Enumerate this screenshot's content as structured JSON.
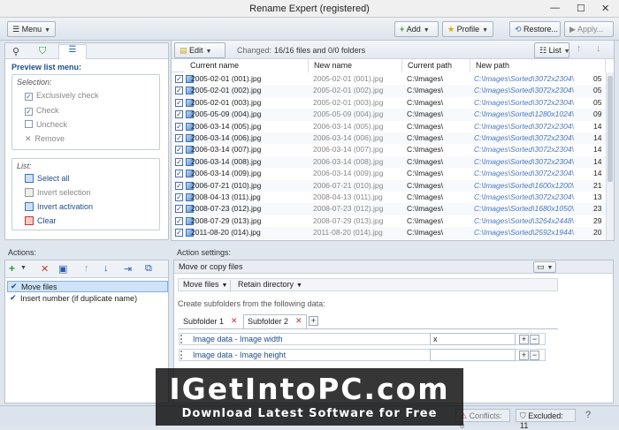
{
  "window": {
    "title": "Rename Expert (registered)"
  },
  "toolbar": {
    "menu": "Menu",
    "add": "Add",
    "profile": "Profile",
    "restore": "Restore...",
    "apply": "Apply..."
  },
  "left": {
    "heading": "Preview list menu:",
    "selection": {
      "title": "Selection:",
      "items": [
        "Exclusively check",
        "Check",
        "Uncheck",
        "Remove"
      ]
    },
    "list": {
      "title": "List:",
      "items": [
        "Select all",
        "Invert selection",
        "Invert activation",
        "Clear"
      ]
    }
  },
  "grid": {
    "edit": "Edit",
    "changed_label": "Changed:",
    "changed_value": "16/16 files and 0/0 folders",
    "view": "List",
    "columns": [
      "Current name",
      "New name",
      "Current path",
      "New path"
    ],
    "rows": [
      {
        "cur": "2005-02-01 (001).jpg",
        "new": "2005-02-01 (001).jpg",
        "path": "C:\\Images\\",
        "np": "C:\\Images\\Sorted\\3072x2304\\",
        "x": "05"
      },
      {
        "cur": "2005-02-01 (002).jpg",
        "new": "2005-02-01 (002).jpg",
        "path": "C:\\Images\\",
        "np": "C:\\Images\\Sorted\\3072x2304\\",
        "x": "05"
      },
      {
        "cur": "2005-02-01 (003).jpg",
        "new": "2005-02-01 (003).jpg",
        "path": "C:\\Images\\",
        "np": "C:\\Images\\Sorted\\3072x2304\\",
        "x": "05"
      },
      {
        "cur": "2005-05-09 (004).jpg",
        "new": "2005-05-09 (004).jpg",
        "path": "C:\\Images\\",
        "np": "C:\\Images\\Sorted\\1280x1024\\",
        "x": "09"
      },
      {
        "cur": "2006-03-14 (005).jpg",
        "new": "2006-03-14 (005).jpg",
        "path": "C:\\Images\\",
        "np": "C:\\Images\\Sorted\\3072x2304\\",
        "x": "14"
      },
      {
        "cur": "2006-03-14 (006).jpg",
        "new": "2006-03-14 (006).jpg",
        "path": "C:\\Images\\",
        "np": "C:\\Images\\Sorted\\3072x2304\\",
        "x": "14"
      },
      {
        "cur": "2006-03-14 (007).jpg",
        "new": "2006-03-14 (007).jpg",
        "path": "C:\\Images\\",
        "np": "C:\\Images\\Sorted\\3072x2304\\",
        "x": "14"
      },
      {
        "cur": "2006-03-14 (008).jpg",
        "new": "2006-03-14 (008).jpg",
        "path": "C:\\Images\\",
        "np": "C:\\Images\\Sorted\\3072x2304\\",
        "x": "14"
      },
      {
        "cur": "2006-03-14 (009).jpg",
        "new": "2006-03-14 (009).jpg",
        "path": "C:\\Images\\",
        "np": "C:\\Images\\Sorted\\3072x2304\\",
        "x": "14"
      },
      {
        "cur": "2006-07-21 (010).jpg",
        "new": "2006-07-21 (010).jpg",
        "path": "C:\\Images\\",
        "np": "C:\\Images\\Sorted\\1600x1200\\",
        "x": "21"
      },
      {
        "cur": "2008-04-13 (011).jpg",
        "new": "2008-04-13 (011).jpg",
        "path": "C:\\Images\\",
        "np": "C:\\Images\\Sorted\\3072x2304\\",
        "x": "13"
      },
      {
        "cur": "2008-07-23 (012).jpg",
        "new": "2008-07-23 (012).jpg",
        "path": "C:\\Images\\",
        "np": "C:\\Images\\Sorted\\1680x1050\\",
        "x": "23"
      },
      {
        "cur": "2008-07-29 (013).jpg",
        "new": "2008-07-29 (013).jpg",
        "path": "C:\\Images\\",
        "np": "C:\\Images\\Sorted\\3264x2448\\",
        "x": "29"
      },
      {
        "cur": "2011-08-20 (014).jpg",
        "new": "2011-08-20 (014).jpg",
        "path": "C:\\Images\\",
        "np": "C:\\Images\\Sorted\\2592x1944\\",
        "x": "20"
      }
    ]
  },
  "actions": {
    "heading": "Actions:",
    "items": [
      "Move files",
      "Insert number (if duplicate name)"
    ]
  },
  "settings": {
    "heading": "Action settings:",
    "panel_title": "Move or copy files",
    "move_select": "Move files",
    "retain_select": "Retain directory",
    "subfolders_label": "Create subfolders from the following data:",
    "tabs": [
      "Subfolder 1",
      "Subfolder 2"
    ],
    "fields": [
      {
        "name": "Image data - Image width",
        "value": "x"
      },
      {
        "name": "Image data - Image height",
        "value": ""
      }
    ]
  },
  "status": {
    "conflicts": "Conflicts: 0",
    "excluded": "Excluded: 11"
  },
  "banner": {
    "line1": "IGetIntoPC.com",
    "line2": "Download Latest Software for Free"
  }
}
